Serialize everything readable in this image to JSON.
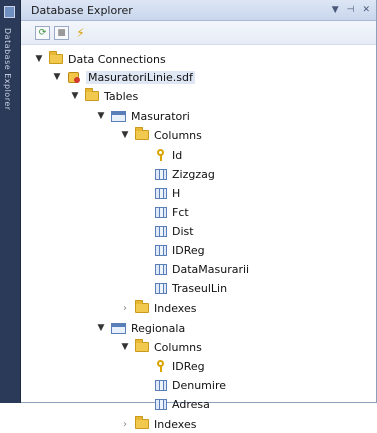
{
  "side_tab": {
    "label": "Database Explorer"
  },
  "panel": {
    "title": "Database Explorer",
    "controls": [
      "▼",
      "⊣",
      "✕"
    ]
  },
  "tree": {
    "data_connections": "Data Connections",
    "database": "MasuratoriLinie.sdf",
    "tables": "Tables",
    "masuratori": {
      "name": "Masuratori",
      "columns_label": "Columns",
      "columns": [
        "Id",
        "Zizgzag",
        "H",
        "Fct",
        "Dist",
        "IDReg",
        "DataMasurarii",
        "TraseulLin"
      ],
      "indexes_label": "Indexes"
    },
    "regionala": {
      "name": "Regionala",
      "columns_label": "Columns",
      "columns": [
        "IDReg",
        "Denumire",
        "Adresa"
      ],
      "indexes_label": "Indexes"
    }
  }
}
